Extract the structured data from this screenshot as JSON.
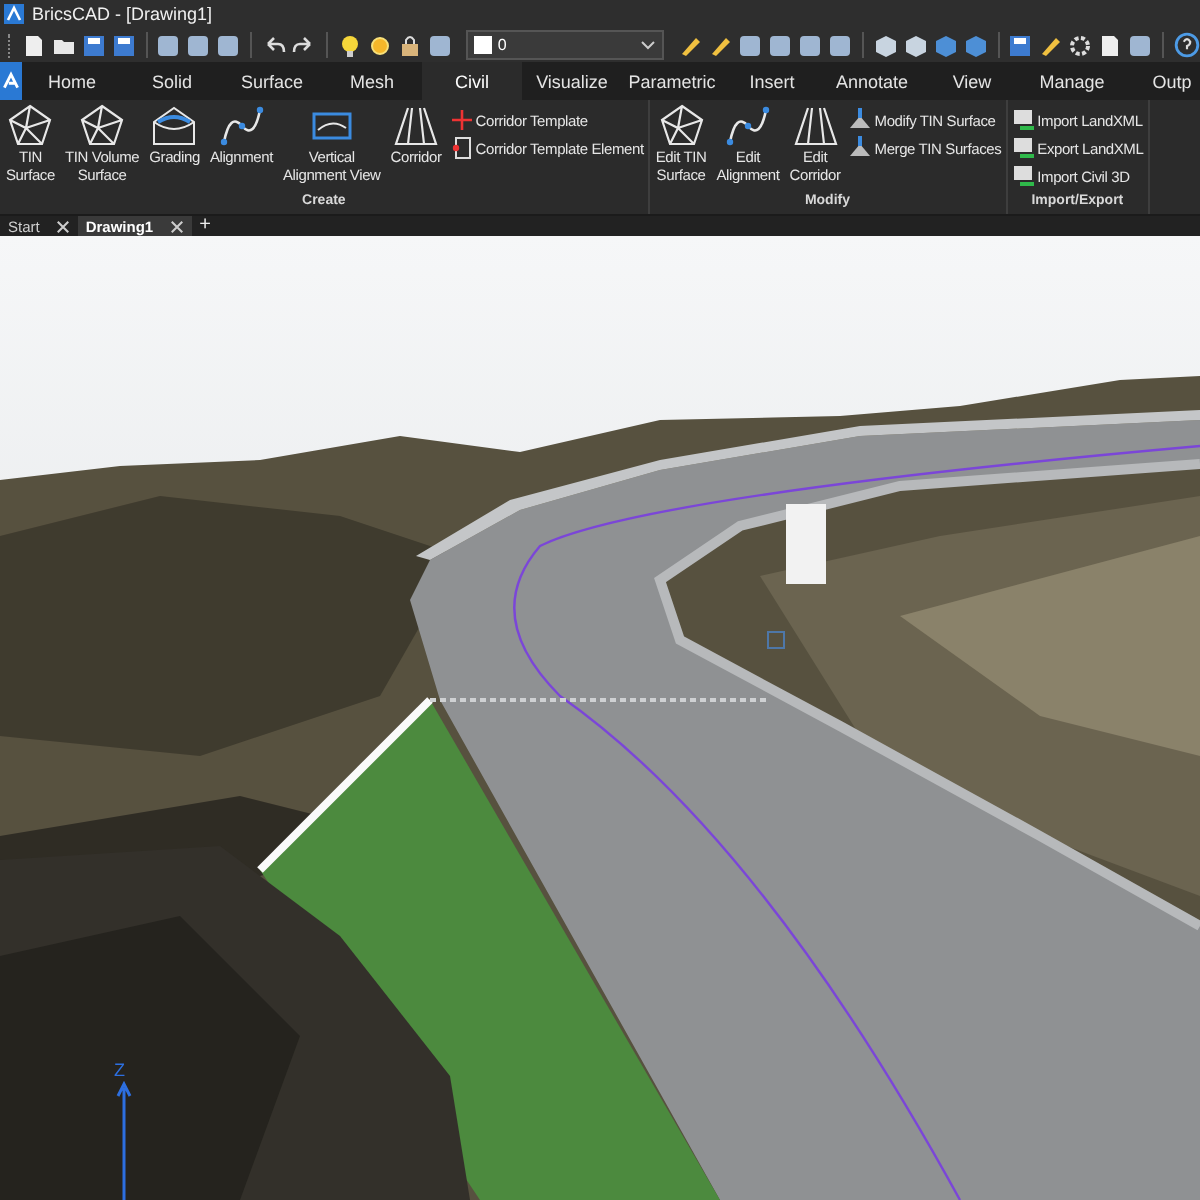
{
  "window": {
    "title": "BricsCAD - [Drawing1]"
  },
  "quick_access": {
    "layer": "0"
  },
  "ribbon_tabs": [
    {
      "label": "Home",
      "selected": false
    },
    {
      "label": "Solid",
      "selected": false
    },
    {
      "label": "Surface",
      "selected": false
    },
    {
      "label": "Mesh",
      "selected": false
    },
    {
      "label": "Civil",
      "selected": true
    },
    {
      "label": "Visualize",
      "selected": false
    },
    {
      "label": "Parametric",
      "selected": false
    },
    {
      "label": "Insert",
      "selected": false
    },
    {
      "label": "Annotate",
      "selected": false
    },
    {
      "label": "View",
      "selected": false
    },
    {
      "label": "Manage",
      "selected": false
    },
    {
      "label": "Outp",
      "selected": false
    }
  ],
  "panels": [
    {
      "title": "Create",
      "large_buttons": [
        {
          "lines": [
            "TIN",
            "Surface"
          ],
          "kind": "tin"
        },
        {
          "lines": [
            "TIN Volume",
            "Surface"
          ],
          "kind": "tin"
        },
        {
          "lines": [
            "Grading"
          ],
          "kind": "grading"
        },
        {
          "lines": [
            "Alignment"
          ],
          "kind": "alignment"
        },
        {
          "lines": [
            "Vertical",
            "Alignment View"
          ],
          "kind": "view"
        },
        {
          "lines": [
            "Corridor"
          ],
          "kind": "corridor"
        }
      ],
      "small_buttons": [
        {
          "label": "Corridor Template",
          "kind": "template"
        },
        {
          "label": "Corridor Template Element",
          "kind": "element"
        }
      ]
    },
    {
      "title": "Modify",
      "large_buttons": [
        {
          "lines": [
            "Edit TIN",
            "Surface"
          ],
          "kind": "tin"
        },
        {
          "lines": [
            "Edit",
            "Alignment"
          ],
          "kind": "alignment"
        },
        {
          "lines": [
            "Edit",
            "Corridor"
          ],
          "kind": "corridor"
        }
      ],
      "small_buttons": [
        {
          "label": "Modify TIN Surface",
          "kind": "surface"
        },
        {
          "label": "Merge TIN Surfaces",
          "kind": "surface"
        }
      ]
    },
    {
      "title": "Import/Export",
      "small_buttons": [
        {
          "label": "Import LandXML",
          "kind": "file"
        },
        {
          "label": "Export LandXML",
          "kind": "file"
        },
        {
          "label": "Import Civil 3D",
          "kind": "file"
        }
      ]
    }
  ],
  "document_tabs": [
    {
      "label": "Start",
      "selected": false
    },
    {
      "label": "Drawing1",
      "selected": true
    }
  ],
  "new_tab_button": "+",
  "viewport": {
    "axis_label": "Z"
  }
}
